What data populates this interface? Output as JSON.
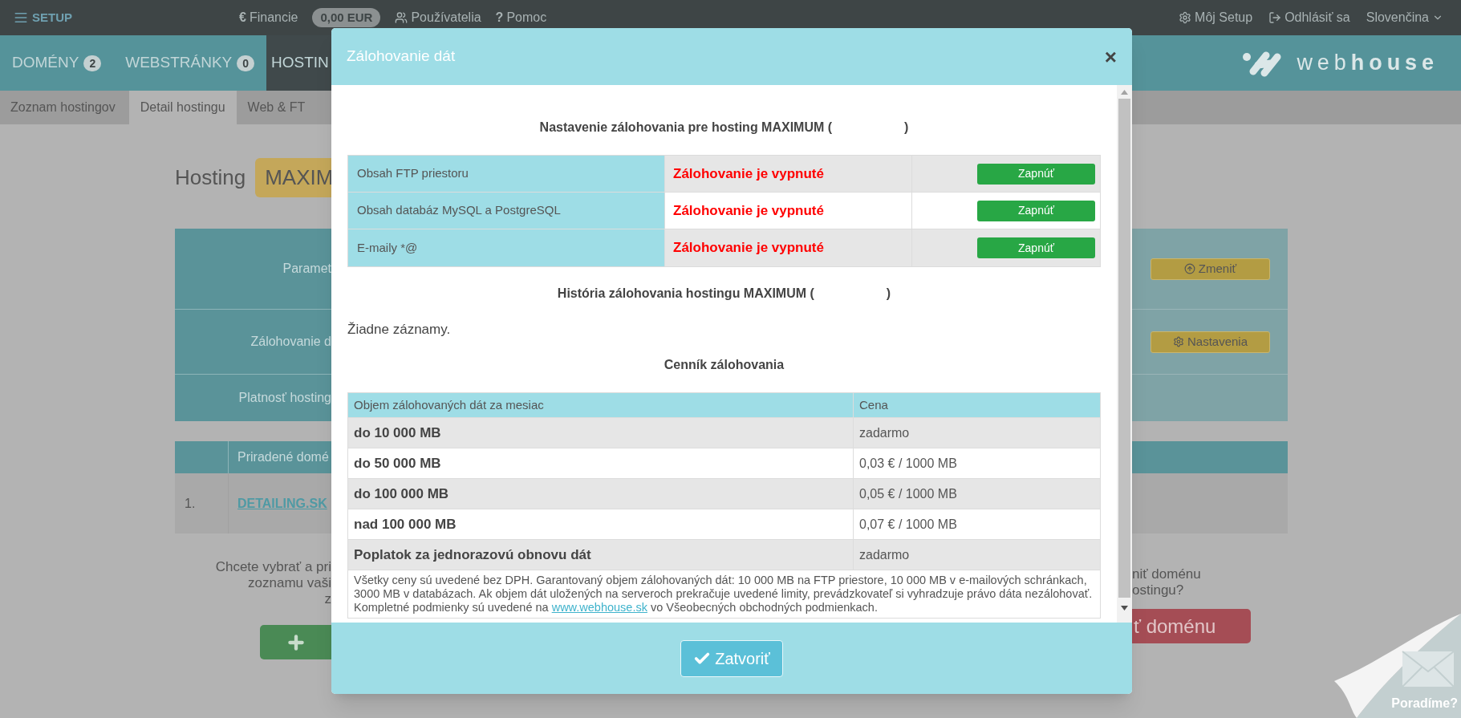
{
  "top_bar": {
    "brand": "SETUP",
    "left_items": [
      {
        "kind": "glyph",
        "glyph": "€",
        "label": "Financie"
      },
      {
        "kind": "balance",
        "label": "0,00 EUR"
      },
      {
        "kind": "users",
        "label": "Používatelia"
      },
      {
        "kind": "glyph",
        "glyph": "?",
        "label": "Pomoc"
      }
    ],
    "right_items": [
      {
        "kind": "settings",
        "label": "Môj Setup"
      },
      {
        "kind": "logout",
        "label": "Odhlásiť sa"
      },
      {
        "kind": "dropdown",
        "label": "Slovenčina"
      }
    ]
  },
  "nav_tabs": [
    {
      "label": "DOMÉNY",
      "count": "2",
      "selected": false
    },
    {
      "label": "WEBSTRÁNKY",
      "count": "0",
      "selected": false
    },
    {
      "label": "HOSTIN",
      "selected": true
    }
  ],
  "logo": {
    "text_1": "web",
    "text_2": "house"
  },
  "sub_tabs": [
    {
      "label": "Zoznam hostingov",
      "selected": false
    },
    {
      "label": "Detail hostingu",
      "selected": true
    },
    {
      "label": "Web & FT",
      "selected": false
    }
  ],
  "page": {
    "title": "Hosting",
    "plan_badge": "MAXIM",
    "params_rows": [
      {
        "label": "Paramet",
        "kind": "upgrade",
        "button": "Zmeniť"
      },
      {
        "label": "Zálohovanie d",
        "kind": "settings",
        "button": "Nastavenia"
      },
      {
        "label": "Platnosť hosting",
        "kind": "plain"
      }
    ],
    "domains_table": {
      "column_2": "Priradené domé",
      "rows": [
        {
          "number": "1.",
          "domain": "DETAILING.SK"
        }
      ]
    },
    "left_text": [
      "Chcete vybrať a pri",
      "zoznamu vaši",
      "z"
    ],
    "right_text": [
      "niť doménu",
      "ostingu?"
    ],
    "right_button": "ť doménu"
  },
  "help_corner": {
    "label": "Poradíme?"
  },
  "modal": {
    "title": "Zálohovanie dát",
    "close": "×",
    "settings_heading": {
      "before": "Nastavenie zálohovania pre hosting MAXIMUM (",
      "after": ")"
    },
    "backup_rows": [
      {
        "label": "Obsah FTP priestoru",
        "status": "Zálohovanie je vypnuté",
        "enabled": false,
        "button": "Zapnúť"
      },
      {
        "label": "Obsah databáz MySQL a PostgreSQL",
        "status": "Zálohovanie je vypnuté",
        "enabled": false,
        "button": "Zapnúť"
      },
      {
        "label": "E-maily *@",
        "status": "Zálohovanie je vypnuté",
        "enabled": false,
        "button": "Zapnúť"
      }
    ],
    "history_heading": {
      "before": "História zálohovania hostingu MAXIMUM (",
      "after": ")"
    },
    "history_empty": "Žiadne záznamy.",
    "pricing_heading": "Cenník zálohovania",
    "pricing_table": {
      "columns": [
        "Objem zálohovaných dát za mesiac",
        "Cena"
      ],
      "rows": [
        {
          "volume": "do 10 000 MB",
          "price": "zadarmo"
        },
        {
          "volume": "do 50 000 MB",
          "price": "0,03 € / 1000 MB"
        },
        {
          "volume": "do 100 000 MB",
          "price": "0,05 € / 1000 MB"
        },
        {
          "volume": "nad 100 000 MB",
          "price": "0,07 € / 1000 MB"
        },
        {
          "volume": "Poplatok za jednorazovú obnovu dát",
          "price": "zadarmo"
        }
      ]
    },
    "note": {
      "before": "Všetky ceny sú uvedené bez DPH. Garantovaný objem zálohovaných dát: 10 000 MB na FTP priestore, 10 000 MB v e-mailových schránkach, 3000 MB v databázach. Ak objem dát uložených na serveroch prekračuje uvedené limity, prevádzkovateľ si vyhradzuje právo dáta nezálohovať. Kompletné podmienky sú uvedené na",
      "link": "www.webhouse.sk",
      "after": "vo Všeobecných obchodných podmienkach."
    },
    "close_button": "Zatvoriť"
  }
}
